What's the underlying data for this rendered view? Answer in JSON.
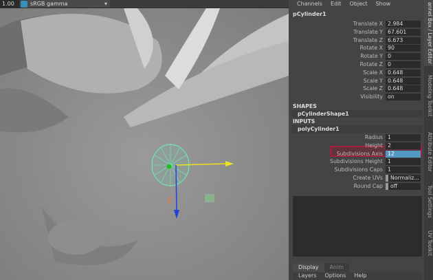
{
  "viewport": {
    "exposure": "1.00",
    "color_space": "sRGB gamma"
  },
  "channel_box": {
    "menu": [
      "Channels",
      "Edit",
      "Object",
      "Show"
    ],
    "object": "pCylinder1",
    "transforms": [
      {
        "label": "Translate X",
        "value": "2.984"
      },
      {
        "label": "Translate Y",
        "value": "67.601"
      },
      {
        "label": "Translate Z",
        "value": "6.673"
      },
      {
        "label": "Rotate X",
        "value": "90"
      },
      {
        "label": "Rotate Y",
        "value": "0"
      },
      {
        "label": "Rotate Z",
        "value": "0"
      },
      {
        "label": "Scale X",
        "value": "0.648"
      },
      {
        "label": "Scale Y",
        "value": "0.648"
      },
      {
        "label": "Scale Z",
        "value": "0.648"
      },
      {
        "label": "Visibility",
        "value": "on"
      }
    ],
    "shapes_header": "SHAPES",
    "shape_node": "pCylinderShape1",
    "inputs_header": "INPUTS",
    "input_node": "polyCylinder1",
    "inputs": [
      {
        "label": "Radius",
        "value": "1"
      },
      {
        "label": "Height",
        "value": "2"
      },
      {
        "label": "Subdivisions Axis",
        "value": "12"
      },
      {
        "label": "Subdivisions Height",
        "value": "1"
      },
      {
        "label": "Subdivisions Caps",
        "value": "1"
      },
      {
        "label": "Create UVs",
        "value": "Normaliz..."
      },
      {
        "label": "Round Cap",
        "value": "off"
      }
    ]
  },
  "layer_editor": {
    "tabs": [
      "Display",
      "Anim"
    ],
    "menu": [
      "Layers",
      "Options",
      "Help"
    ]
  },
  "side_tabs": [
    "annel Box / Layer Editor",
    "Modeling Toolkit",
    "Attribute Editor",
    "Tool Settings",
    "UV Toolkit"
  ]
}
